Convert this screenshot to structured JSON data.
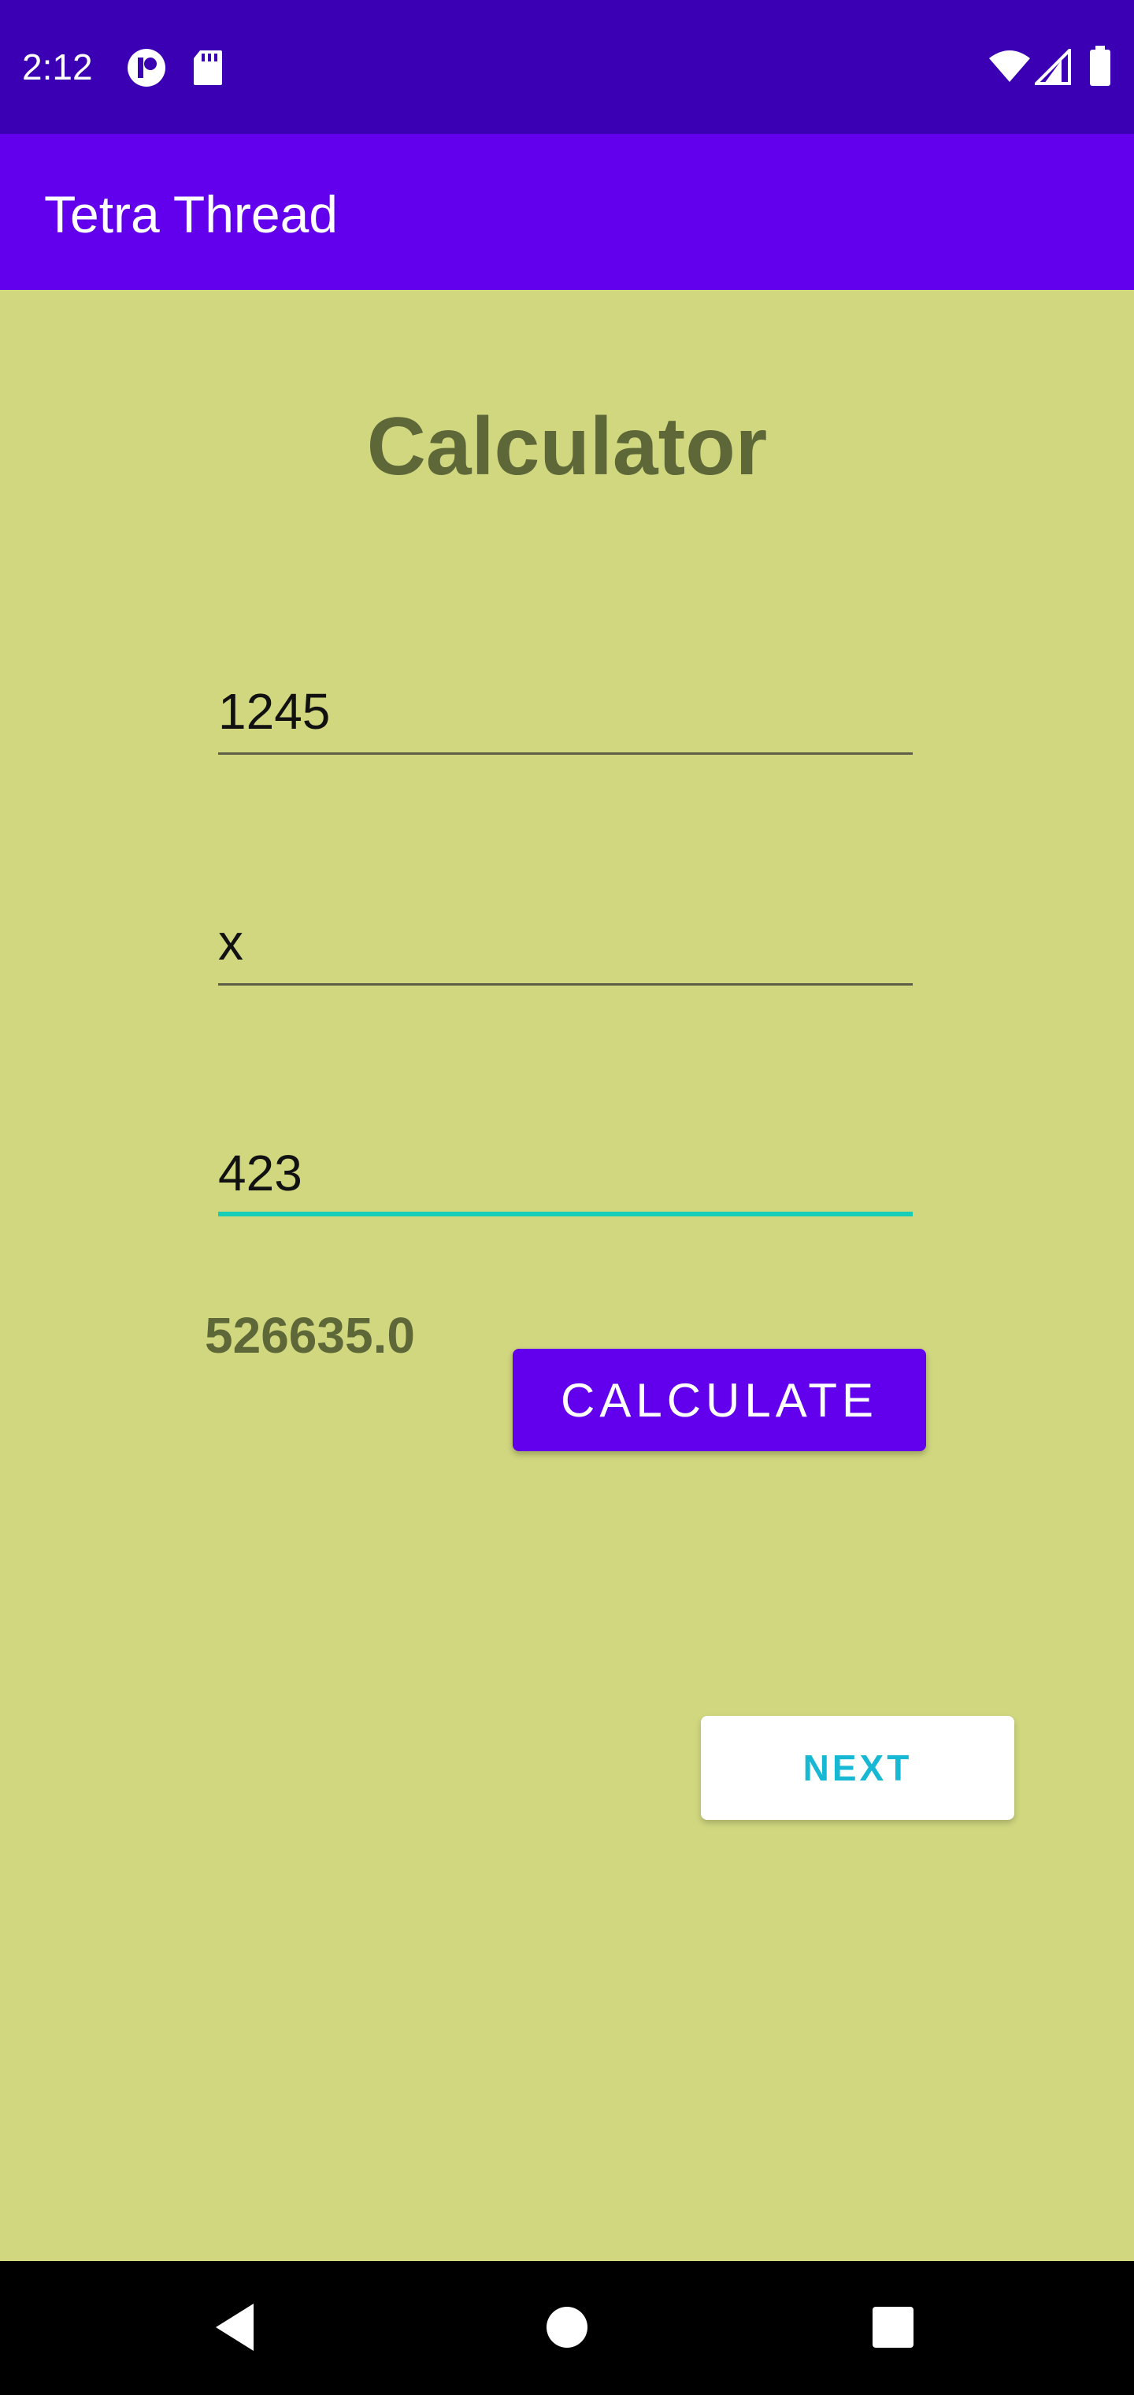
{
  "status_bar": {
    "time": "2:12",
    "icons_left": [
      "app-notification-icon",
      "sd-card-icon"
    ],
    "icons_right": [
      "wifi-icon",
      "cell-signal-icon",
      "battery-icon"
    ]
  },
  "app_bar": {
    "title": "Tetra Thread"
  },
  "main": {
    "title": "Calculator",
    "fields": [
      {
        "value": "1245"
      },
      {
        "value": "x"
      },
      {
        "value": "423"
      }
    ],
    "result": "526635.0",
    "calculate_label": "CALCULATE",
    "next_label": "NEXT"
  },
  "nav_bar": {
    "buttons": [
      "back-icon",
      "home-icon",
      "recents-icon"
    ]
  },
  "colors": {
    "status_bar": "#3b00b3",
    "app_bar": "#6200ee",
    "background": "#d0d77f",
    "title_text": "#5d6738",
    "focus_underline": "#16cdb8",
    "next_text": "#17b8d4"
  }
}
